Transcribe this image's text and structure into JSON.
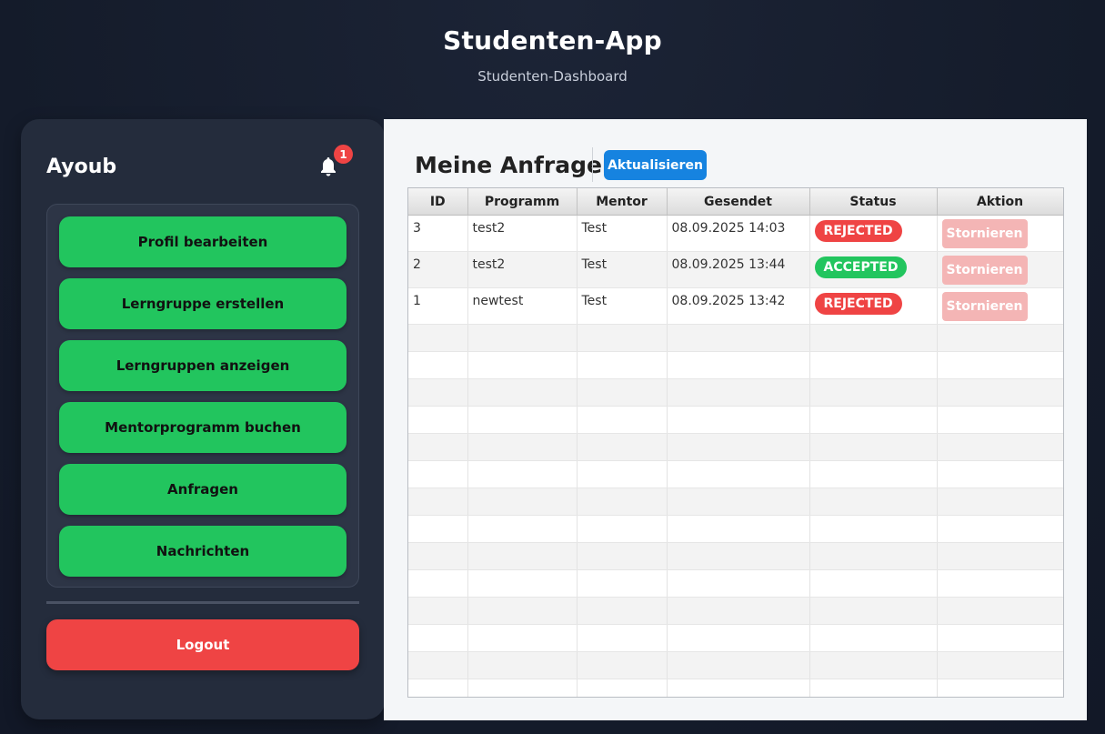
{
  "header": {
    "title": "Studenten-App",
    "subtitle": "Studenten-Dashboard"
  },
  "sidebar": {
    "user_name": "Ayoub",
    "notification_count": "1",
    "menu_items": [
      {
        "label": "Profil bearbeiten"
      },
      {
        "label": "Lerngruppe erstellen"
      },
      {
        "label": "Lerngruppen anzeigen"
      },
      {
        "label": "Mentorprogramm buchen"
      },
      {
        "label": "Anfragen"
      },
      {
        "label": "Nachrichten"
      }
    ],
    "logout_label": "Logout"
  },
  "main": {
    "title": "Meine Anfragen",
    "refresh_label": "Aktualisieren",
    "columns": [
      "ID",
      "Programm",
      "Mentor",
      "Gesendet",
      "Status",
      "Aktion"
    ],
    "rows": [
      {
        "id": "3",
        "program": "test2",
        "mentor": "Test",
        "sent": "08.09.2025 14:03",
        "status": "REJECTED",
        "action": "Stornieren"
      },
      {
        "id": "2",
        "program": "test2",
        "mentor": "Test",
        "sent": "08.09.2025 13:44",
        "status": "ACCEPTED",
        "action": "Stornieren"
      },
      {
        "id": "1",
        "program": "newtest",
        "mentor": "Test",
        "sent": "08.09.2025 13:42",
        "status": "REJECTED",
        "action": "Stornieren"
      }
    ]
  },
  "colors": {
    "accent_green": "#22c55e",
    "danger_red": "#ef4444",
    "primary_blue": "#1683e0",
    "cancel_disabled": "#f4b5b5",
    "sidebar_bg": "#242c3c"
  },
  "icons": {
    "notification": "bell-icon"
  }
}
